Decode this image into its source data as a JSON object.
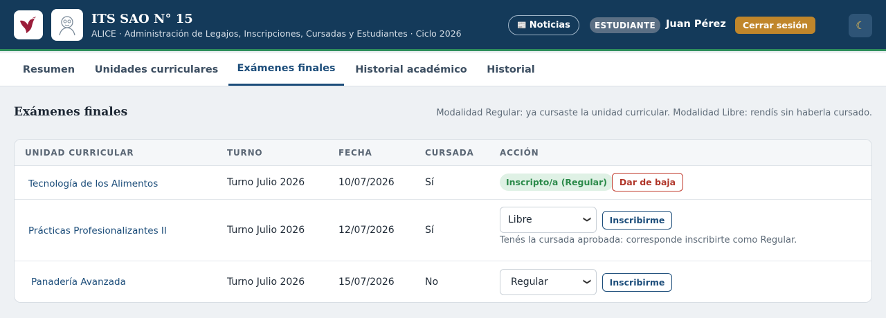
{
  "header": {
    "institution": "ITS SAO N° 15",
    "subtitle": "ALICE · Administración de Legajos, Inscripciones, Cursadas y Estudiantes · Ciclo 2026",
    "news_label": "Noticias",
    "news_icon": "newspaper-icon",
    "role": "ESTUDIANTE",
    "user": "Juan Pérez",
    "logout_label": "Cerrar sesión",
    "theme_icon": "moon-icon"
  },
  "tabs": [
    {
      "label": "Resumen",
      "active": false
    },
    {
      "label": "Unidades curriculares",
      "active": false
    },
    {
      "label": "Exámenes finales",
      "active": true
    },
    {
      "label": "Historial académico",
      "active": false
    },
    {
      "label": "Historial",
      "active": false
    }
  ],
  "section": {
    "title": "Exámenes finales",
    "hint": "Modalidad Regular: ya cursaste la unidad curricular. Modalidad Libre: rendís sin haberla cursado."
  },
  "table": {
    "headers": [
      "UNIDAD CURRICULAR",
      "TURNO",
      "FECHA",
      "CURSADA",
      "ACCIÓN"
    ],
    "rows": [
      {
        "unit": "Tecnología de los Alimentos",
        "turno": "Turno Julio 2026",
        "fecha": "10/07/2026",
        "cursada": "Sí",
        "status": "Inscripto/a (Regular)",
        "action_label": "Dar de baja"
      },
      {
        "unit": "Prácticas Profesionalizantes II",
        "turno": "Turno Julio 2026",
        "fecha": "12/07/2026",
        "cursada": "Sí",
        "select_value": "Libre",
        "action_label": "Inscribirme",
        "note": "Tenés la cursada aprobada: corresponde inscribirte como Regular."
      },
      {
        "unit": "Panadería Avanzada",
        "turno": "Turno Julio 2026",
        "fecha": "15/07/2026",
        "cursada": "No",
        "select_value": "Regular",
        "action_label": "Inscribirme"
      }
    ]
  },
  "colors": {
    "header_bg": "#143a5a",
    "accent_line": "#2f8f5b",
    "logout_bg": "#c0862b",
    "primary": "#1c4d7a",
    "success": "#2b8a4a",
    "danger": "#c0392b"
  }
}
